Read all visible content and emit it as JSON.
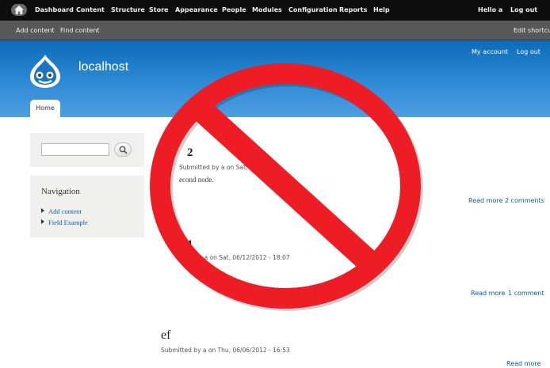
{
  "toolbar": {
    "items": [
      "Dashboard",
      "Content",
      "Structure",
      "Store",
      "Appearance",
      "People",
      "Modules",
      "Configuration",
      "Reports",
      "Help"
    ],
    "greeting": "Hello a",
    "logout": "Log out"
  },
  "shortcuts": {
    "items": [
      "Add content",
      "Find content"
    ],
    "edit": "Edit shortcuts"
  },
  "header": {
    "site_name": "localhost",
    "my_account": "My account",
    "logout": "Log out",
    "tab": "Home"
  },
  "sidebar": {
    "navigation_title": "Navigation",
    "nav_items": [
      "Add content",
      "Field Example"
    ]
  },
  "nodes": [
    {
      "title": "2",
      "meta": "Submitted by a on Sat, 07",
      "body": "econd node.",
      "read_more": "Read more",
      "comments": "2 comments"
    },
    {
      "title": "1",
      "meta": "by a on Sat, 06/12/2012 - 18:07",
      "read_more": "Read more",
      "comments": "1 comment"
    },
    {
      "title": "ef",
      "meta": "Submitted by a on Thu, 06/06/2012 - 16:53",
      "read_more": "Read more"
    }
  ],
  "colors": {
    "toolbar_bg": "#0d0d0d",
    "shortcut_bg": "#585858",
    "header_blue": "#2f8ad5",
    "ban_red": "#ee1c24",
    "link_blue": "#0b5ba0"
  },
  "icons": {
    "home": "home-icon",
    "search": "search-icon",
    "logo": "drupal-drop-logo",
    "overlay": "prohibition-sign"
  }
}
